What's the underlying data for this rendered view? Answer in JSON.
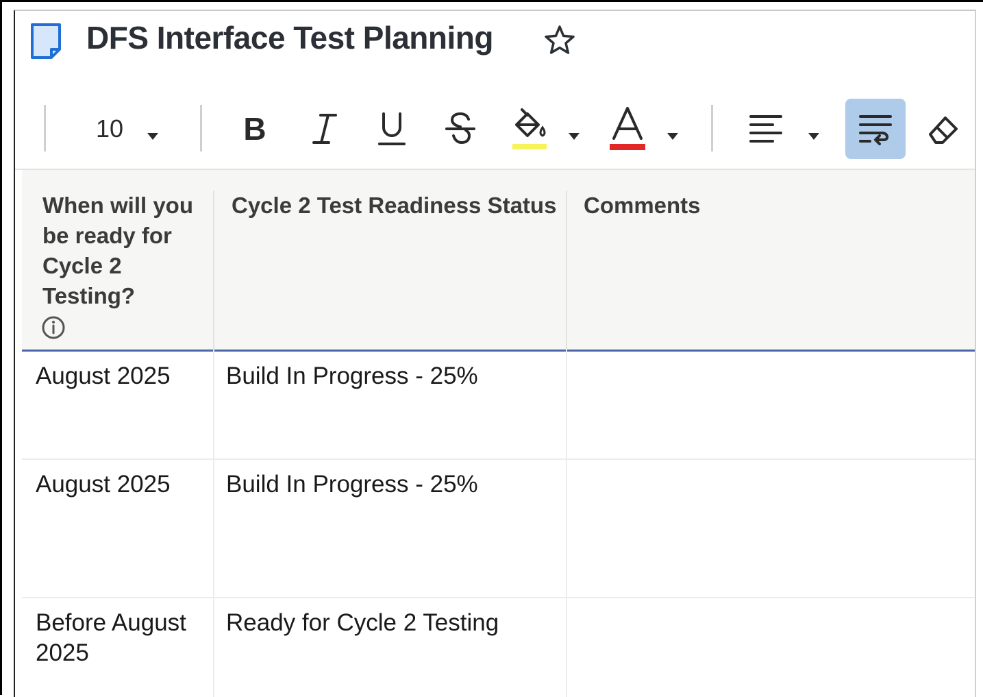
{
  "document": {
    "title": "DFS Interface Test Planning"
  },
  "toolbar": {
    "font_size": "10",
    "bold_label": "B",
    "highlight_color": "#f7f35a",
    "text_color": "#e32626",
    "wrap_active_color": "#aecbea"
  },
  "table": {
    "columns": [
      {
        "header": "When will you be ready for Cycle 2 Testing?"
      },
      {
        "header": "Cycle 2 Test Readiness Status"
      },
      {
        "header": "Comments"
      }
    ],
    "rows": [
      {
        "ready": "August 2025",
        "status": "Build In Progress - 25%",
        "comments": ""
      },
      {
        "ready": "August 2025",
        "status": "Build In Progress - 25%",
        "comments": ""
      },
      {
        "ready": "Before August 2025",
        "status": "Ready for Cycle 2 Testing",
        "comments": ""
      }
    ]
  }
}
